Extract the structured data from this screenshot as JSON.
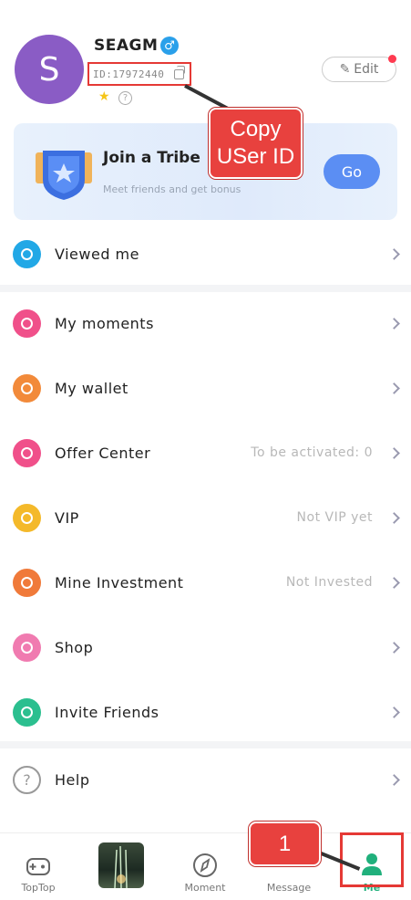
{
  "profile": {
    "avatar_letter": "S",
    "username": "SEAGM",
    "gender_symbol": "♂",
    "user_id": "ID:17972440",
    "edit_label": "Edit"
  },
  "annotations": {
    "copy_line1": "Copy",
    "copy_line2": "USer ID",
    "step_number": "1"
  },
  "tribe": {
    "title": "Join a Tribe",
    "subtitle": "Meet friends and get bonus",
    "go_label": "Go"
  },
  "menu": [
    {
      "label": "Viewed me",
      "status": "",
      "color": "#22a8e6"
    },
    {
      "label": "My moments",
      "status": "",
      "color": "#f0508a"
    },
    {
      "label": "My wallet",
      "status": "",
      "color": "#f28a3a"
    },
    {
      "label": "Offer Center",
      "status": "To be activated: 0",
      "color": "#f0508a"
    },
    {
      "label": "VIP",
      "status": "Not VIP yet",
      "color": "#f4b92a"
    },
    {
      "label": "Mine Investment",
      "status": "Not Invested",
      "color": "#f07a3a"
    },
    {
      "label": "Shop",
      "status": "",
      "color": "#f07bb0"
    },
    {
      "label": "Invite Friends",
      "status": "",
      "color": "#2bbf8f"
    },
    {
      "label": "Help",
      "status": "",
      "color": "#999999"
    }
  ],
  "nav": {
    "toptop": "TopTop",
    "moment": "Moment",
    "message": "Message",
    "me": "Me"
  }
}
